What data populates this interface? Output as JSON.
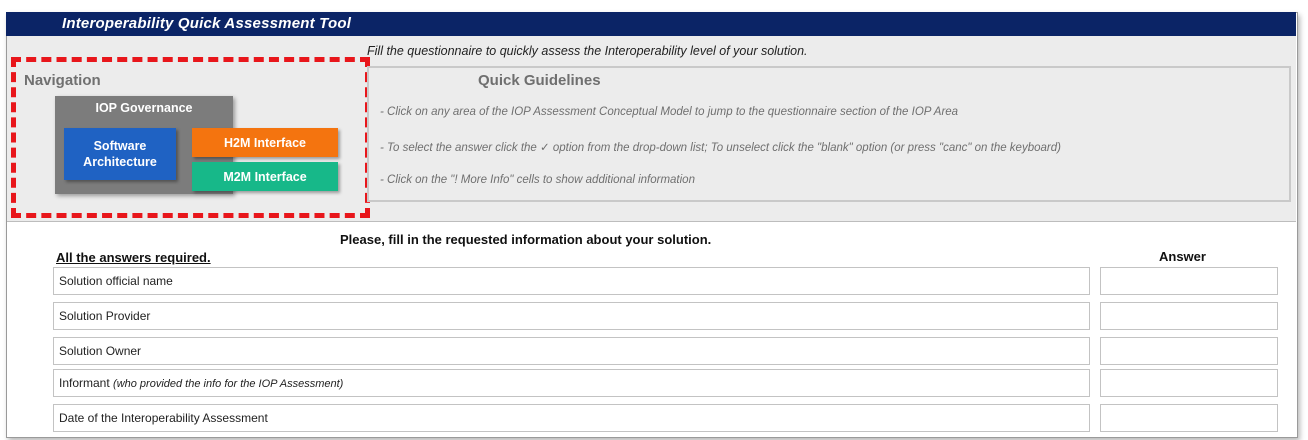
{
  "title": "Interoperability Quick Assessment Tool",
  "intro": "Fill the questionnaire to quickly assess the Interoperability level of your solution.",
  "navigation": {
    "title": "Navigation",
    "governance": "IOP Governance",
    "software_line1": "Software",
    "software_line2": "Architecture",
    "h2m": "H2M Interface",
    "m2m": "M2M Interface"
  },
  "guidelines": {
    "title": "Quick Guidelines",
    "line1": "- Click on any area of the IOP Assessment Conceptual Model to jump to the questionnaire section of the IOP Area",
    "line2": "- To select the answer click the ✓   option from the drop-down list; To unselect click the  \"blank\" option (or press \"canc\" on the keyboard)",
    "line3": "- Click on the \"! More Info\" cells to show additional information"
  },
  "form": {
    "heading": "Please, fill in the requested information about your solution.",
    "required": "All the answers required.",
    "answer_header": "Answer",
    "rows": [
      {
        "label": "Solution official name",
        "note": "",
        "answer": ""
      },
      {
        "label": "Solution Provider",
        "note": "",
        "answer": ""
      },
      {
        "label": "Solution Owner",
        "note": "",
        "answer": ""
      },
      {
        "label": "Informant ",
        "note": "(who provided the info for the IOP Assessment)",
        "answer": ""
      },
      {
        "label": "Date of the Interoperability Assessment",
        "note": "",
        "answer": ""
      }
    ]
  },
  "colors": {
    "title_bar": "#0b2466",
    "highlight_dash": "#e8161b",
    "governance": "#7c7c7c",
    "software": "#1f62c3",
    "h2m": "#f4740f",
    "m2m": "#17b889"
  }
}
